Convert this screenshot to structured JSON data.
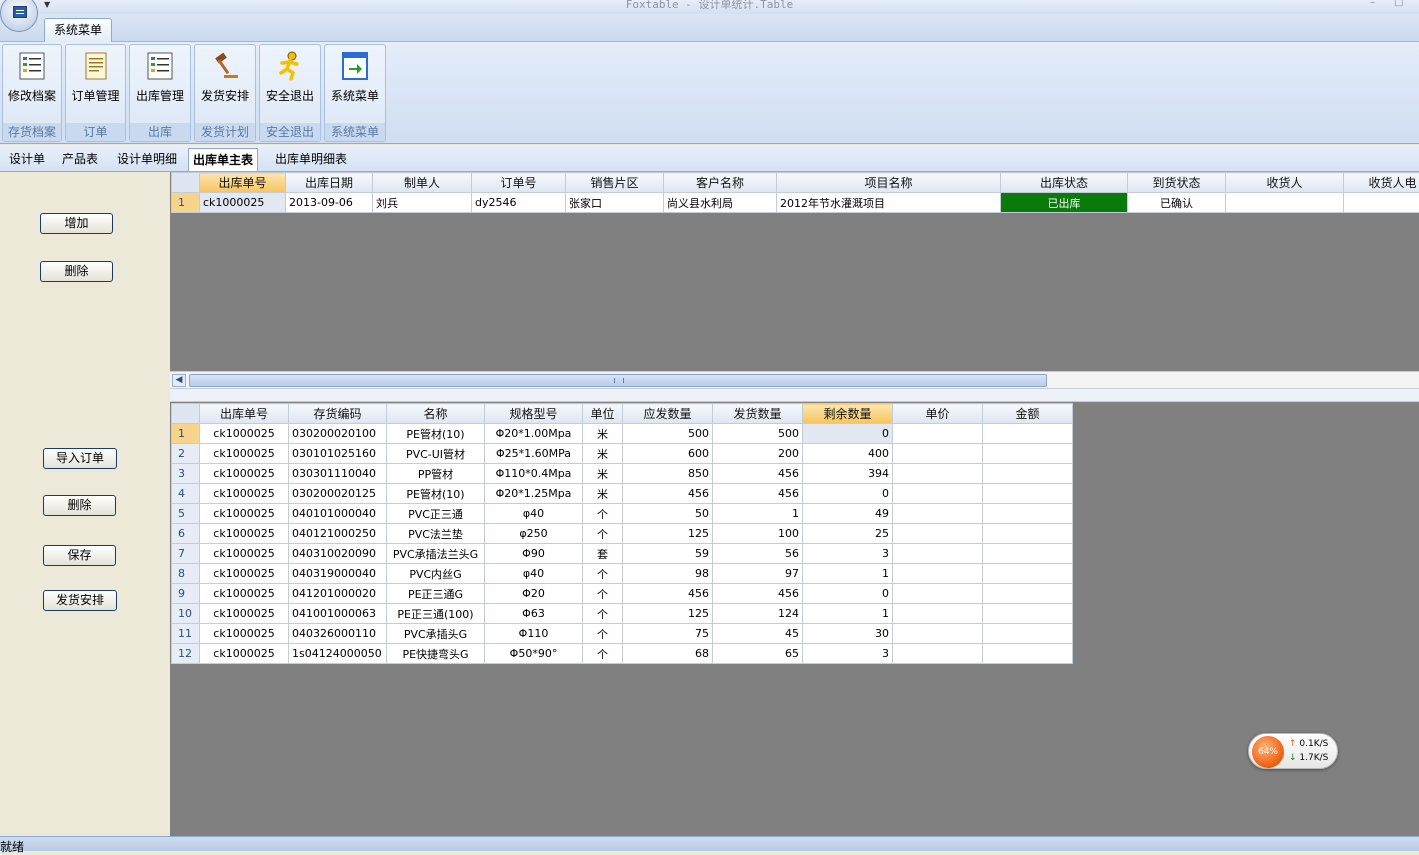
{
  "window": {
    "title": "Foxtable - 设计单统计.Table"
  },
  "ribbon": {
    "tab": "系统菜单",
    "groups": [
      {
        "button": "修改档案",
        "group": "存货档案",
        "icon": "list-icon"
      },
      {
        "button": "订单管理",
        "group": "订单",
        "icon": "document-icon"
      },
      {
        "button": "出库管理",
        "group": "出库",
        "icon": "list-icon"
      },
      {
        "button": "发货安排",
        "group": "发货计划",
        "icon": "gavel-icon"
      },
      {
        "button": "安全退出",
        "group": "安全退出",
        "icon": "runner-icon"
      },
      {
        "button": "系统菜单",
        "group": "系统菜单",
        "icon": "exit-door-icon"
      }
    ]
  },
  "doc_tabs": [
    "设计单",
    "产品表",
    "设计单明细",
    "出库单主表",
    "出库单明细表"
  ],
  "side": {
    "top_buttons": [
      "增加",
      "删除"
    ],
    "bottom_buttons": [
      "导入订单",
      "删除",
      "保存",
      "发货安排"
    ]
  },
  "colors": {
    "shipped_green": "#0a7b0a",
    "header_selected": "#f6c45f"
  },
  "master": {
    "columns": [
      "出库单号",
      "出库日期",
      "制单人",
      "订单号",
      "销售片区",
      "客户名称",
      "项目名称",
      "出库状态",
      "到货状态",
      "收货人",
      "收货人电"
    ],
    "rows": [
      {
        "n": "1",
        "cells": [
          "ck1000025",
          "2013-09-06",
          "刘兵",
          "dy2546",
          "张家口",
          "尚义县水利局",
          "2012年节水灌溉项目",
          "已出库",
          "已确认",
          "",
          ""
        ]
      }
    ]
  },
  "detail": {
    "columns": [
      "出库单号",
      "存货编码",
      "名称",
      "规格型号",
      "单位",
      "应发数量",
      "发货数量",
      "剩余数量",
      "单价",
      "金额"
    ],
    "rows": [
      {
        "n": "1",
        "cells": [
          "ck1000025",
          "030200020100",
          "PE管材(10)",
          "Φ20*1.00Mpa",
          "米",
          "500",
          "500",
          "0",
          "",
          ""
        ]
      },
      {
        "n": "2",
        "cells": [
          "ck1000025",
          "030101025160",
          "PVC-UI管材",
          "Φ25*1.60MPa",
          "米",
          "600",
          "200",
          "400",
          "",
          ""
        ]
      },
      {
        "n": "3",
        "cells": [
          "ck1000025",
          "030301110040",
          "PP管材",
          "Φ110*0.4Mpa",
          "米",
          "850",
          "456",
          "394",
          "",
          ""
        ]
      },
      {
        "n": "4",
        "cells": [
          "ck1000025",
          "030200020125",
          "PE管材(10)",
          "Φ20*1.25Mpa",
          "米",
          "456",
          "456",
          "0",
          "",
          ""
        ]
      },
      {
        "n": "5",
        "cells": [
          "ck1000025",
          "040101000040",
          "PVC正三通",
          "φ40",
          "个",
          "50",
          "1",
          "49",
          "",
          ""
        ]
      },
      {
        "n": "6",
        "cells": [
          "ck1000025",
          "040121000250",
          "PVC法兰垫",
          "φ250",
          "个",
          "125",
          "100",
          "25",
          "",
          ""
        ]
      },
      {
        "n": "7",
        "cells": [
          "ck1000025",
          "040310020090",
          "PVC承插法兰头G",
          "Φ90",
          "套",
          "59",
          "56",
          "3",
          "",
          ""
        ]
      },
      {
        "n": "8",
        "cells": [
          "ck1000025",
          "040319000040",
          "PVC内丝G",
          "φ40",
          "个",
          "98",
          "97",
          "1",
          "",
          ""
        ]
      },
      {
        "n": "9",
        "cells": [
          "ck1000025",
          "041201000020",
          "PE正三通G",
          "Φ20",
          "个",
          "456",
          "456",
          "0",
          "",
          ""
        ]
      },
      {
        "n": "10",
        "cells": [
          "ck1000025",
          "041001000063",
          "PE正三通(100)",
          "Φ63",
          "个",
          "125",
          "124",
          "1",
          "",
          ""
        ]
      },
      {
        "n": "11",
        "cells": [
          "ck1000025",
          "040326000110",
          "PVC承插头G",
          "Φ110",
          "个",
          "75",
          "45",
          "30",
          "",
          ""
        ]
      },
      {
        "n": "12",
        "cells": [
          "ck1000025",
          "1s04124000050",
          "PE快捷弯头G",
          "Φ50*90°",
          "个",
          "68",
          "65",
          "3",
          "",
          ""
        ]
      }
    ]
  },
  "status": {
    "text": "就绪"
  },
  "net_widget": {
    "percent": "64%",
    "up": "0.1K/S",
    "down": "1.7K/S"
  }
}
